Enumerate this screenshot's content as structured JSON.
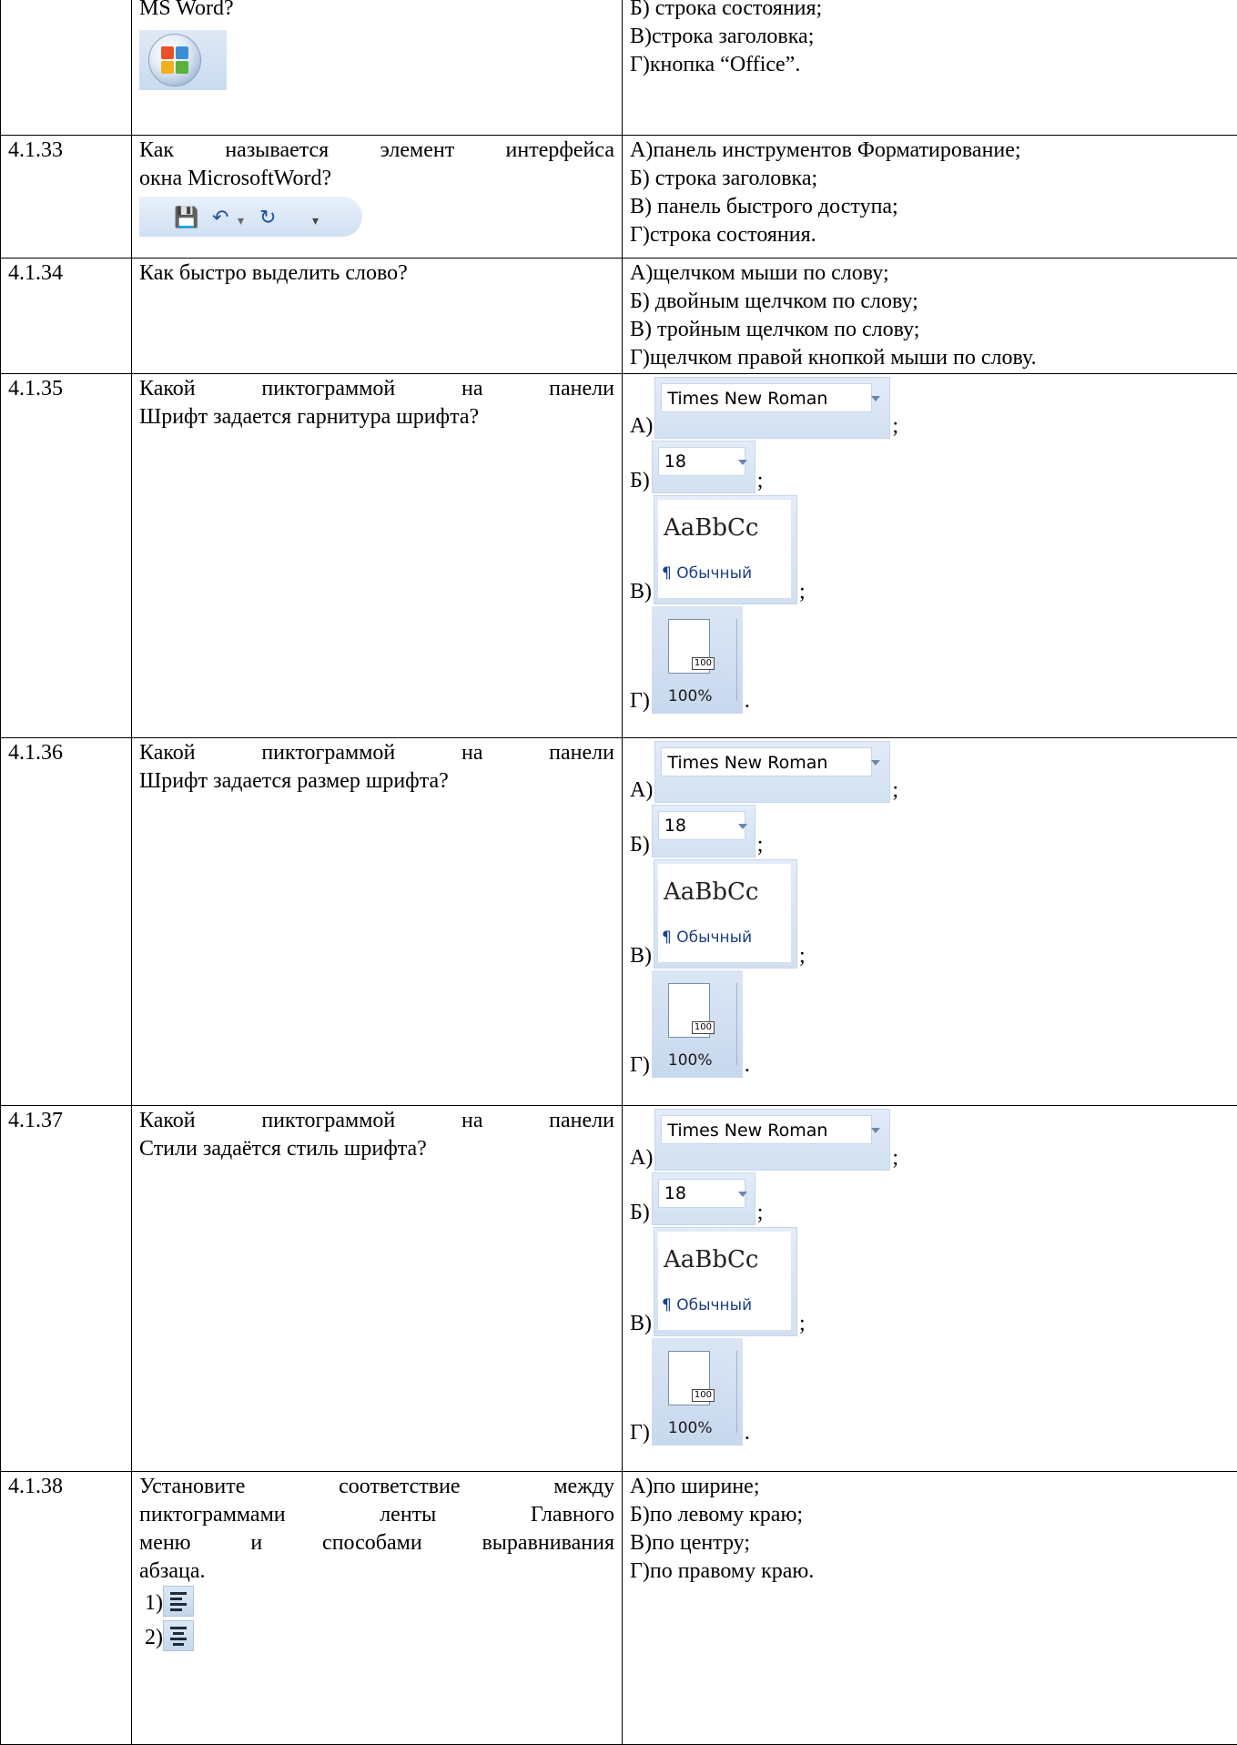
{
  "rows": [
    {
      "number": "",
      "question_lines": [
        "MS Word?"
      ],
      "question_icon": "office-button-icon",
      "answers": [
        "Б) строка состояния;",
        "В)строка заголовка;",
        "Г)кнопка “Office”."
      ]
    },
    {
      "number": "4.1.33",
      "question_lines": [
        "Как называется элемент интерфейса",
        "окна MicrosoftWord?"
      ],
      "question_icon": "quick-access-toolbar-icon",
      "answers": [
        "А)панель инструментов Форматирование;",
        "Б) строка заголовка;",
        "В) панель быстрого доступа;",
        "Г)строка состояния."
      ]
    },
    {
      "number": "4.1.34",
      "question_lines": [
        "Как быстро выделить слово?"
      ],
      "answers": [
        "А)щелчком мыши по слову;",
        "Б) двойным щелчком по слову;",
        "В) тройным щелчком по слову;",
        "Г)щелчком правой кнопкой мыши по слову."
      ]
    },
    {
      "number": "4.1.35",
      "question_lines": [
        "Какой пиктограммой на панели",
        "Шрифт задается гарнитура шрифта?"
      ]
    },
    {
      "number": "4.1.36",
      "question_lines": [
        "Какой пиктограммой на панели",
        "Шрифт задается размер шрифта?"
      ]
    },
    {
      "number": "4.1.37",
      "question_lines": [
        "Какой пиктограммой на панели",
        "Стили задаётся стиль шрифта?"
      ]
    },
    {
      "number": "4.1.38",
      "question_lines": [
        "Установите соответствие между",
        "пиктограммами ленты Главного",
        "меню и способами выравнивания",
        "абзаца."
      ],
      "items": [
        "1)",
        "2)"
      ],
      "answers": [
        "А)по ширине;",
        "Б)по левому краю;",
        "В)по центру;",
        "Г)по правому краю."
      ]
    }
  ],
  "icon_options": {
    "a_letter": "А)",
    "b_letter": "Б)",
    "v_letter": "В)",
    "g_letter": "Г)",
    "sep": ";",
    "end": ".",
    "font_name": "Times New Roman",
    "font_size": "18",
    "style_sample": "AaBbCc",
    "style_name": "¶ Обычный",
    "zoom_tag": "100",
    "zoom_percent": "100%"
  },
  "colors": {
    "ribbon_blue": "#d2e0f1",
    "style_name_blue": "#1c3f8a"
  }
}
